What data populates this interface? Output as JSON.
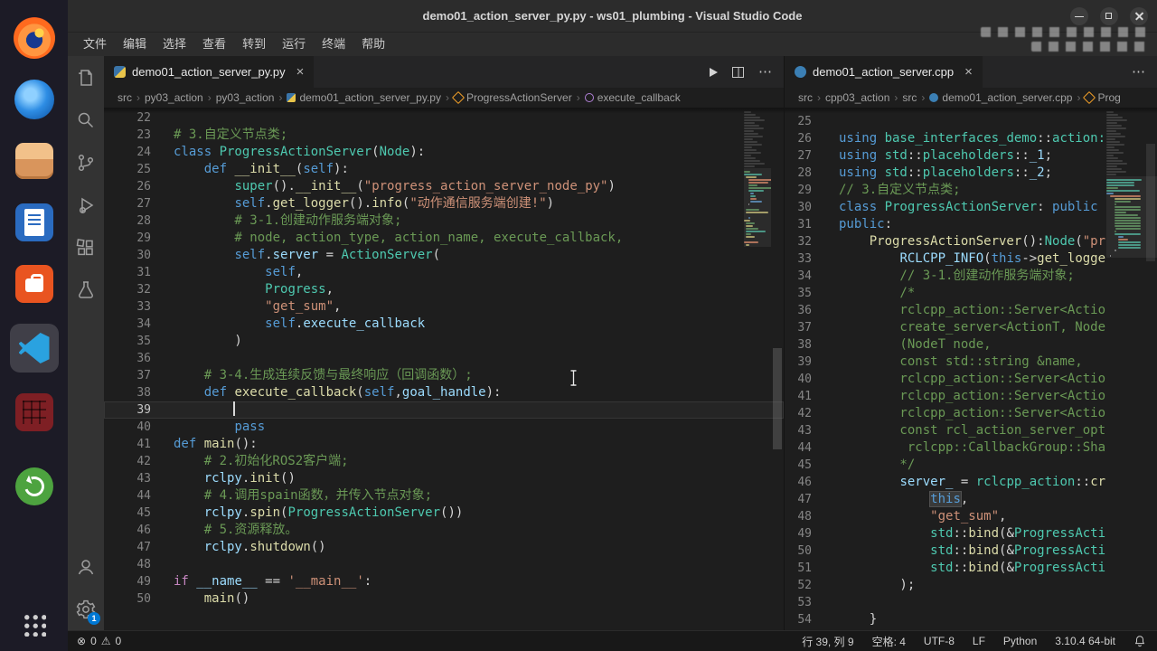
{
  "window": {
    "title": "demo01_action_server_py.py - ws01_plumbing - Visual Studio Code",
    "controls": [
      "minimize",
      "maximize",
      "close"
    ]
  },
  "menu_bar": {
    "items": [
      "文件",
      "编辑",
      "选择",
      "查看",
      "转到",
      "运行",
      "终端",
      "帮助"
    ]
  },
  "dock": {
    "icons": [
      "firefox",
      "thunderbird",
      "files",
      "libreoffice-writer",
      "ubuntu-software",
      "vscode",
      "red-grid-app",
      "software-updater",
      "show-applications"
    ]
  },
  "activity_bar": {
    "icons": [
      "explorer",
      "search",
      "source-control",
      "run-debug",
      "extensions",
      "testing"
    ],
    "bottom_icons": [
      "account",
      "settings-gear"
    ],
    "settings_badge": "1"
  },
  "icons": {
    "more_glyph": "⋯",
    "close_glyph": "×",
    "crumb_sep": "›",
    "error_glyph": "⊗",
    "warning_glyph": "⚠"
  },
  "colors": {
    "accent": "#007acc",
    "keyword": "#569cd6",
    "control": "#c586c0",
    "class": "#4ec9b0",
    "function": "#dcdcaa",
    "string": "#ce9178",
    "comment": "#6a9955",
    "variable": "#9cdcfe",
    "text": "#d4d4d4"
  },
  "left_editor": {
    "tab": {
      "label": "demo01_action_server_py.py"
    },
    "breadcrumbs": [
      {
        "label": "src"
      },
      {
        "label": "py03_action"
      },
      {
        "label": "py03_action"
      },
      {
        "label": "demo01_action_server_py.py",
        "icon": "pyfile"
      },
      {
        "label": "ProgressActionServer",
        "icon": "class"
      },
      {
        "label": "execute_callback",
        "icon": "method"
      }
    ],
    "cursor": {
      "line": 39,
      "col": 9
    },
    "lines": [
      {
        "n": 22,
        "t": []
      },
      {
        "n": 23,
        "t": [
          [
            "# 3.自定义节点类;",
            "com"
          ]
        ]
      },
      {
        "n": 24,
        "t": [
          [
            "class ",
            "kw"
          ],
          [
            "ProgressActionServer",
            "cls"
          ],
          [
            "(",
            "def"
          ],
          [
            "Node",
            "cls"
          ],
          [
            "):",
            "def"
          ]
        ]
      },
      {
        "n": 25,
        "t": [
          [
            "    ",
            "def"
          ],
          [
            "def ",
            "kw"
          ],
          [
            "__init__",
            "fn"
          ],
          [
            "(",
            "def"
          ],
          [
            "self",
            "self"
          ],
          [
            "):",
            "def"
          ]
        ]
      },
      {
        "n": 26,
        "t": [
          [
            "        ",
            "def"
          ],
          [
            "super",
            "cls"
          ],
          [
            "().",
            "def"
          ],
          [
            "__init__",
            "fn"
          ],
          [
            "(",
            "def"
          ],
          [
            "\"progress_action_server_node_py\"",
            "str"
          ],
          [
            ")",
            "def"
          ]
        ]
      },
      {
        "n": 27,
        "t": [
          [
            "        ",
            "def"
          ],
          [
            "self",
            "self"
          ],
          [
            ".",
            "def"
          ],
          [
            "get_logger",
            "fn"
          ],
          [
            "().",
            "def"
          ],
          [
            "info",
            "fn"
          ],
          [
            "(",
            "def"
          ],
          [
            "\"动作通信服务端创建!\"",
            "str"
          ],
          [
            ")",
            "def"
          ]
        ]
      },
      {
        "n": 28,
        "t": [
          [
            "        # 3-1.创建动作服务端对象;",
            "com"
          ]
        ]
      },
      {
        "n": 29,
        "t": [
          [
            "        # node, action_type, action_name, execute_callback,",
            "com"
          ]
        ]
      },
      {
        "n": 30,
        "t": [
          [
            "        ",
            "def"
          ],
          [
            "self",
            "self"
          ],
          [
            ".",
            "def"
          ],
          [
            "server",
            "var"
          ],
          [
            " = ",
            "def"
          ],
          [
            "ActionServer",
            "cls"
          ],
          [
            "(",
            "def"
          ]
        ]
      },
      {
        "n": 31,
        "t": [
          [
            "            ",
            "def"
          ],
          [
            "self",
            "self"
          ],
          [
            ",",
            "def"
          ]
        ]
      },
      {
        "n": 32,
        "t": [
          [
            "            ",
            "def"
          ],
          [
            "Progress",
            "cls"
          ],
          [
            ",",
            "def"
          ]
        ]
      },
      {
        "n": 33,
        "t": [
          [
            "            ",
            "def"
          ],
          [
            "\"get_sum\"",
            "str"
          ],
          [
            ",",
            "def"
          ]
        ]
      },
      {
        "n": 34,
        "t": [
          [
            "            ",
            "def"
          ],
          [
            "self",
            "self"
          ],
          [
            ".",
            "def"
          ],
          [
            "execute_callback",
            "var"
          ]
        ]
      },
      {
        "n": 35,
        "t": [
          [
            "        )",
            "def"
          ]
        ]
      },
      {
        "n": 36,
        "t": []
      },
      {
        "n": 37,
        "t": [
          [
            "    # 3-4.生成连续反馈与最终响应（回调函数）;",
            "com"
          ]
        ]
      },
      {
        "n": 38,
        "t": [
          [
            "    ",
            "def"
          ],
          [
            "def ",
            "kw"
          ],
          [
            "execute_callback",
            "fn"
          ],
          [
            "(",
            "def"
          ],
          [
            "self",
            "self"
          ],
          [
            ",",
            "def"
          ],
          [
            "goal_handle",
            "var"
          ],
          [
            "):",
            "def"
          ]
        ]
      },
      {
        "n": 39,
        "t": [
          [
            "        ",
            "def"
          ]
        ],
        "cur": true
      },
      {
        "n": 40,
        "t": [
          [
            "        ",
            "def"
          ],
          [
            "pass",
            "kw"
          ]
        ]
      },
      {
        "n": 41,
        "t": [
          [
            "def ",
            "kw"
          ],
          [
            "main",
            "fn"
          ],
          [
            "():",
            "def"
          ]
        ]
      },
      {
        "n": 42,
        "t": [
          [
            "    # 2.初始化ROS2客户端;",
            "com"
          ]
        ]
      },
      {
        "n": 43,
        "t": [
          [
            "    ",
            "def"
          ],
          [
            "rclpy",
            "var"
          ],
          [
            ".",
            "def"
          ],
          [
            "init",
            "fn"
          ],
          [
            "()",
            "def"
          ]
        ]
      },
      {
        "n": 44,
        "t": [
          [
            "    # 4.调用spain函数，并传入节点对象;",
            "com"
          ]
        ]
      },
      {
        "n": 45,
        "t": [
          [
            "    ",
            "def"
          ],
          [
            "rclpy",
            "var"
          ],
          [
            ".",
            "def"
          ],
          [
            "spin",
            "fn"
          ],
          [
            "(",
            "def"
          ],
          [
            "ProgressActionServer",
            "cls"
          ],
          [
            "())",
            "def"
          ]
        ]
      },
      {
        "n": 46,
        "t": [
          [
            "    # 5.资源释放。",
            "com"
          ]
        ]
      },
      {
        "n": 47,
        "t": [
          [
            "    ",
            "def"
          ],
          [
            "rclpy",
            "var"
          ],
          [
            ".",
            "def"
          ],
          [
            "shutdown",
            "fn"
          ],
          [
            "()",
            "def"
          ]
        ]
      },
      {
        "n": 48,
        "t": []
      },
      {
        "n": 49,
        "t": [
          [
            "if ",
            "ctrl"
          ],
          [
            "__name__",
            "var"
          ],
          [
            " ",
            "def"
          ],
          [
            "==",
            "def"
          ],
          [
            " ",
            "def"
          ],
          [
            "'__main__'",
            "str"
          ],
          [
            ":",
            "def"
          ]
        ]
      },
      {
        "n": 50,
        "t": [
          [
            "    ",
            "def"
          ],
          [
            "main",
            "fn"
          ],
          [
            "()",
            "def"
          ]
        ]
      }
    ]
  },
  "right_editor": {
    "tab": {
      "label": "demo01_action_server.cpp"
    },
    "breadcrumbs": [
      {
        "label": "src"
      },
      {
        "label": "cpp03_action"
      },
      {
        "label": "src"
      },
      {
        "label": "demo01_action_server.cpp",
        "icon": "cppfile"
      },
      {
        "label": "Prog",
        "icon": "class"
      }
    ],
    "lines": [
      {
        "n": 25,
        "t": []
      },
      {
        "n": 26,
        "t": [
          [
            "using ",
            "kw"
          ],
          [
            "base_interfaces_demo",
            "cls"
          ],
          [
            "::",
            "def"
          ],
          [
            "action:",
            "cls"
          ]
        ]
      },
      {
        "n": 27,
        "t": [
          [
            "using ",
            "kw"
          ],
          [
            "std",
            "cls"
          ],
          [
            "::",
            "def"
          ],
          [
            "placeholders",
            "cls"
          ],
          [
            "::",
            "def"
          ],
          [
            "_1",
            "var"
          ],
          [
            ";",
            "def"
          ]
        ]
      },
      {
        "n": 28,
        "t": [
          [
            "using ",
            "kw"
          ],
          [
            "std",
            "cls"
          ],
          [
            "::",
            "def"
          ],
          [
            "placeholders",
            "cls"
          ],
          [
            "::",
            "def"
          ],
          [
            "_2",
            "var"
          ],
          [
            ";",
            "def"
          ]
        ]
      },
      {
        "n": 29,
        "t": [
          [
            "// 3.自定义节点类;",
            "com"
          ]
        ]
      },
      {
        "n": 30,
        "t": [
          [
            "class ",
            "kw"
          ],
          [
            "ProgressActionServer",
            "cls"
          ],
          [
            ": ",
            "def"
          ],
          [
            "public",
            "kw"
          ]
        ]
      },
      {
        "n": 31,
        "t": [
          [
            "public",
            "kw"
          ],
          [
            ":",
            "def"
          ]
        ]
      },
      {
        "n": 32,
        "t": [
          [
            "    ",
            "def"
          ],
          [
            "ProgressActionServer",
            "fn"
          ],
          [
            "():",
            "def"
          ],
          [
            "Node",
            "cls"
          ],
          [
            "(",
            "def"
          ],
          [
            "\"pr",
            "str"
          ]
        ]
      },
      {
        "n": 33,
        "t": [
          [
            "        ",
            "def"
          ],
          [
            "RCLCPP_INFO",
            "var"
          ],
          [
            "(",
            "def"
          ],
          [
            "this",
            "kw"
          ],
          [
            "->",
            "def"
          ],
          [
            "get_logge",
            "fn"
          ]
        ]
      },
      {
        "n": 34,
        "t": [
          [
            "        // 3-1.创建动作服务端对象;",
            "com"
          ]
        ]
      },
      {
        "n": 35,
        "t": [
          [
            "        /*",
            "com"
          ]
        ]
      },
      {
        "n": 36,
        "t": [
          [
            "        rclcpp_action::Server<Actio",
            "com"
          ]
        ]
      },
      {
        "n": 37,
        "t": [
          [
            "        create_server<ActionT, Node",
            "com"
          ]
        ]
      },
      {
        "n": 38,
        "t": [
          [
            "        (NodeT node,",
            "com"
          ]
        ]
      },
      {
        "n": 39,
        "t": [
          [
            "        const std::string &name,",
            "com"
          ]
        ]
      },
      {
        "n": 40,
        "t": [
          [
            "        rclcpp_action::Server<Actio",
            "com"
          ]
        ]
      },
      {
        "n": 41,
        "t": [
          [
            "        rclcpp_action::Server<Actio",
            "com"
          ]
        ]
      },
      {
        "n": 42,
        "t": [
          [
            "        rclcpp_action::Server<Actio",
            "com"
          ]
        ]
      },
      {
        "n": 43,
        "t": [
          [
            "        const rcl_action_server_opt",
            "com"
          ]
        ]
      },
      {
        "n": 44,
        "t": [
          [
            "         rclcpp::CallbackGroup::Sha",
            "com"
          ]
        ]
      },
      {
        "n": 45,
        "t": [
          [
            "        */",
            "com"
          ]
        ]
      },
      {
        "n": 46,
        "t": [
          [
            "        ",
            "def"
          ],
          [
            "server_",
            "var"
          ],
          [
            " = ",
            "def"
          ],
          [
            "rclcpp_action",
            "cls"
          ],
          [
            "::",
            "def"
          ],
          [
            "cr",
            "fn"
          ]
        ]
      },
      {
        "n": 47,
        "t": [
          [
            "            ",
            "def"
          ],
          [
            "this",
            "hl"
          ],
          [
            ",",
            "def"
          ]
        ]
      },
      {
        "n": 48,
        "t": [
          [
            "            ",
            "def"
          ],
          [
            "\"get_sum\"",
            "str"
          ],
          [
            ",",
            "def"
          ]
        ]
      },
      {
        "n": 49,
        "t": [
          [
            "            ",
            "def"
          ],
          [
            "std",
            "cls"
          ],
          [
            "::",
            "def"
          ],
          [
            "bind",
            "fn"
          ],
          [
            "(&",
            "def"
          ],
          [
            "ProgressActi",
            "cls"
          ]
        ]
      },
      {
        "n": 50,
        "t": [
          [
            "            ",
            "def"
          ],
          [
            "std",
            "cls"
          ],
          [
            "::",
            "def"
          ],
          [
            "bind",
            "fn"
          ],
          [
            "(&",
            "def"
          ],
          [
            "ProgressActi",
            "cls"
          ]
        ]
      },
      {
        "n": 51,
        "t": [
          [
            "            ",
            "def"
          ],
          [
            "std",
            "cls"
          ],
          [
            "::",
            "def"
          ],
          [
            "bind",
            "fn"
          ],
          [
            "(&",
            "def"
          ],
          [
            "ProgressActi",
            "cls"
          ]
        ]
      },
      {
        "n": 52,
        "t": [
          [
            "        );",
            "def"
          ]
        ]
      },
      {
        "n": 53,
        "t": []
      },
      {
        "n": 54,
        "t": [
          [
            "    }",
            "def"
          ]
        ]
      }
    ]
  },
  "status_bar": {
    "errors": "0",
    "warnings": "0",
    "right_items": [
      "行 39, 列 9",
      "空格: 4",
      "UTF-8",
      "LF",
      "Python",
      "3.10.4 64-bit"
    ]
  }
}
